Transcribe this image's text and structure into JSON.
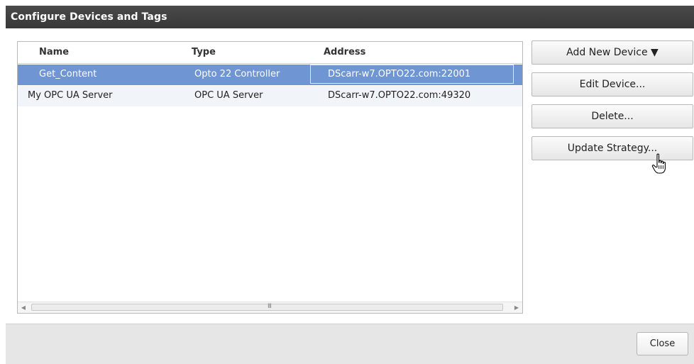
{
  "dialog": {
    "title": "Configure Devices and Tags"
  },
  "device_table": {
    "columns": [
      "Name",
      "Type",
      "Address"
    ],
    "rows": [
      {
        "name": "Get_Content",
        "type": "Opto 22 Controller",
        "address": "DScarr-w7.OPTO22.com:22001",
        "selected": true
      },
      {
        "name": "My OPC UA Server",
        "type": "OPC UA Server",
        "address": "DScarr-w7.OPTO22.com:49320",
        "selected": false
      }
    ],
    "scroll_grip": "III",
    "scroll_left": "◀",
    "scroll_right": "▶"
  },
  "actions": {
    "add_new_device": "Add New Device ▼",
    "edit_device": "Edit Device...",
    "delete": "Delete...",
    "update_strategy": "Update Strategy..."
  },
  "footer": {
    "close_label": "Close"
  },
  "icons": {
    "cursor": "hand-pointer-icon"
  },
  "colors": {
    "titlebar": "#3f3f3f",
    "selected_row": "#6f95d2",
    "footer": "#e6e6e6"
  }
}
